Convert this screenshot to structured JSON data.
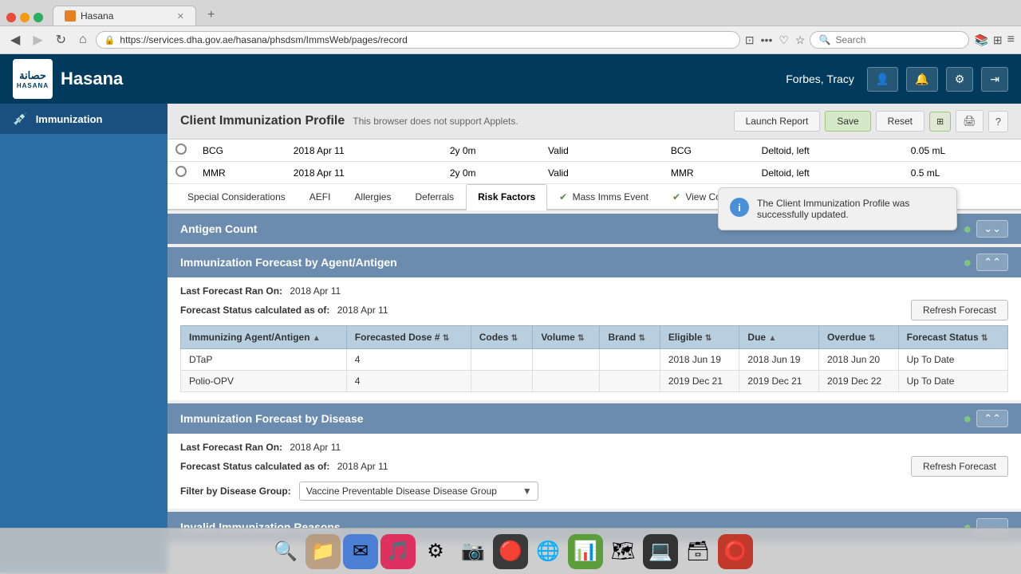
{
  "browser": {
    "tab_label": "Hasana",
    "tab_favicon_color": "#e67e22",
    "url": "https://services.dha.gov.ae/hasana/phsdsm/ImmsWeb/pages/record",
    "search_placeholder": "Search"
  },
  "app": {
    "logo_arabic": "حصانة",
    "logo_english": "HASANA",
    "title": "Hasana",
    "user_name": "Forbes, Tracy",
    "header_buttons": {
      "user_icon": "👤",
      "bell_icon": "🔔",
      "settings_icon": "⚙",
      "exit_icon": "→"
    }
  },
  "sidebar": {
    "items": [
      {
        "label": "Immunization",
        "icon": "💉",
        "active": true
      }
    ]
  },
  "profile": {
    "title": "Client Immunization Profile",
    "subtitle": "This browser does not support Applets.",
    "buttons": {
      "launch_report": "Launch Report",
      "save": "Save",
      "reset": "Reset"
    }
  },
  "top_table": {
    "rows": [
      {
        "type": "BCG",
        "date": "2018 Apr 11",
        "age": "2y 0m",
        "status": "Valid",
        "vaccine": "BCG",
        "site": "Deltoid, left",
        "dose": "0.05 mL"
      },
      {
        "type": "MMR",
        "date": "2018 Apr 11",
        "age": "2y 0m",
        "status": "Valid",
        "vaccine": "MMR",
        "site": "Deltoid, left",
        "dose": "0.5 mL"
      }
    ]
  },
  "tabs": {
    "items": [
      {
        "label": "Special Considerations",
        "active": false,
        "check": false
      },
      {
        "label": "AEFI",
        "active": false,
        "check": false
      },
      {
        "label": "Allergies",
        "active": false,
        "check": false
      },
      {
        "label": "Deferrals",
        "active": false,
        "check": false
      },
      {
        "label": "Risk Factors",
        "active": true,
        "check": false
      },
      {
        "label": "Mass Imms Event",
        "active": false,
        "check": true
      },
      {
        "label": "View Co...",
        "active": false,
        "check": true
      }
    ]
  },
  "notification": {
    "icon": "i",
    "message": "The Client Immunization Profile was successfully updated."
  },
  "antigen_count": {
    "section_title": "Antigen Count",
    "collapse_icon": "⌄⌄"
  },
  "forecast_agent": {
    "section_title": "Immunization Forecast by Agent/Antigen",
    "last_forecast_label": "Last Forecast Ran On:",
    "last_forecast_date": "2018 Apr 11",
    "status_label": "Forecast Status calculated as of:",
    "status_date": "2018 Apr 11",
    "refresh_btn": "Refresh Forecast",
    "table": {
      "headers": [
        "Immunizing Agent/Antigen",
        "Forecasted Dose #",
        "Codes",
        "Volume",
        "Brand",
        "Eligible",
        "Due",
        "Overdue",
        "Forecast Status"
      ],
      "rows": [
        {
          "agent": "DTaP",
          "dose": "4",
          "codes": "",
          "volume": "",
          "brand": "",
          "eligible": "2018 Jun 19",
          "due": "2018 Jun 19",
          "overdue": "2018 Jun 20",
          "status": "Up To Date"
        },
        {
          "agent": "Polio-OPV",
          "dose": "4",
          "codes": "",
          "volume": "",
          "brand": "",
          "eligible": "2019 Dec 21",
          "due": "2019 Dec 21",
          "overdue": "2019 Dec 22",
          "status": "Up To Date"
        }
      ]
    }
  },
  "forecast_disease": {
    "section_title": "Immunization Forecast by Disease",
    "last_forecast_label": "Last Forecast Ran On:",
    "last_forecast_date": "2018 Apr 11",
    "status_label": "Forecast Status calculated as of:",
    "status_date": "2018 Apr 11",
    "refresh_btn": "Refresh Forecast",
    "filter_label": "Filter by Disease Group:",
    "filter_value": "Vaccine Preventable Disease Disease Group",
    "filter_options": [
      "Vaccine Preventable Disease Disease Group"
    ]
  },
  "invalid_section": {
    "section_title": "Invalid Immunization Reasons",
    "collapse_icon": "⌄⌄"
  },
  "dock": {
    "items": [
      "🔍",
      "🗂",
      "📁",
      "🎵",
      "⚙",
      "📷",
      "🔴",
      "🌐",
      "📊",
      "🎯",
      "💻",
      "🗃",
      "🔵"
    ]
  }
}
